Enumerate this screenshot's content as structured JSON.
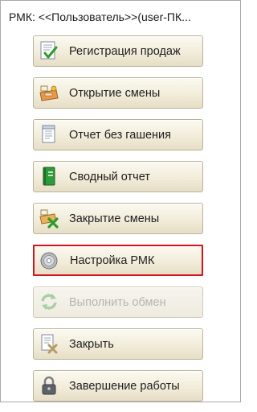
{
  "window": {
    "title": "РМК: <<Пользователь>>(user-ПК..."
  },
  "menu": {
    "items": [
      {
        "label": "Регистрация продаж",
        "icon": "sales-register-icon"
      },
      {
        "label": "Открытие смены",
        "icon": "cash-register-open-icon"
      },
      {
        "label": "Отчет без гашения",
        "icon": "report-document-icon"
      },
      {
        "label": "Сводный отчет",
        "icon": "green-book-icon"
      },
      {
        "label": "Закрытие смены",
        "icon": "cash-register-close-icon"
      },
      {
        "label": "Настройка РМК",
        "icon": "settings-disc-icon",
        "selected": true
      },
      {
        "label": "Выполнить обмен",
        "icon": "sync-arrows-icon",
        "disabled": true
      },
      {
        "label": "Закрыть",
        "icon": "close-document-icon"
      },
      {
        "label": "Завершение работы",
        "icon": "padlock-icon"
      }
    ]
  },
  "colors": {
    "selected_border": "#d0151d",
    "button_face": "#f2ecda",
    "disabled_text": "#b5b5b5"
  }
}
